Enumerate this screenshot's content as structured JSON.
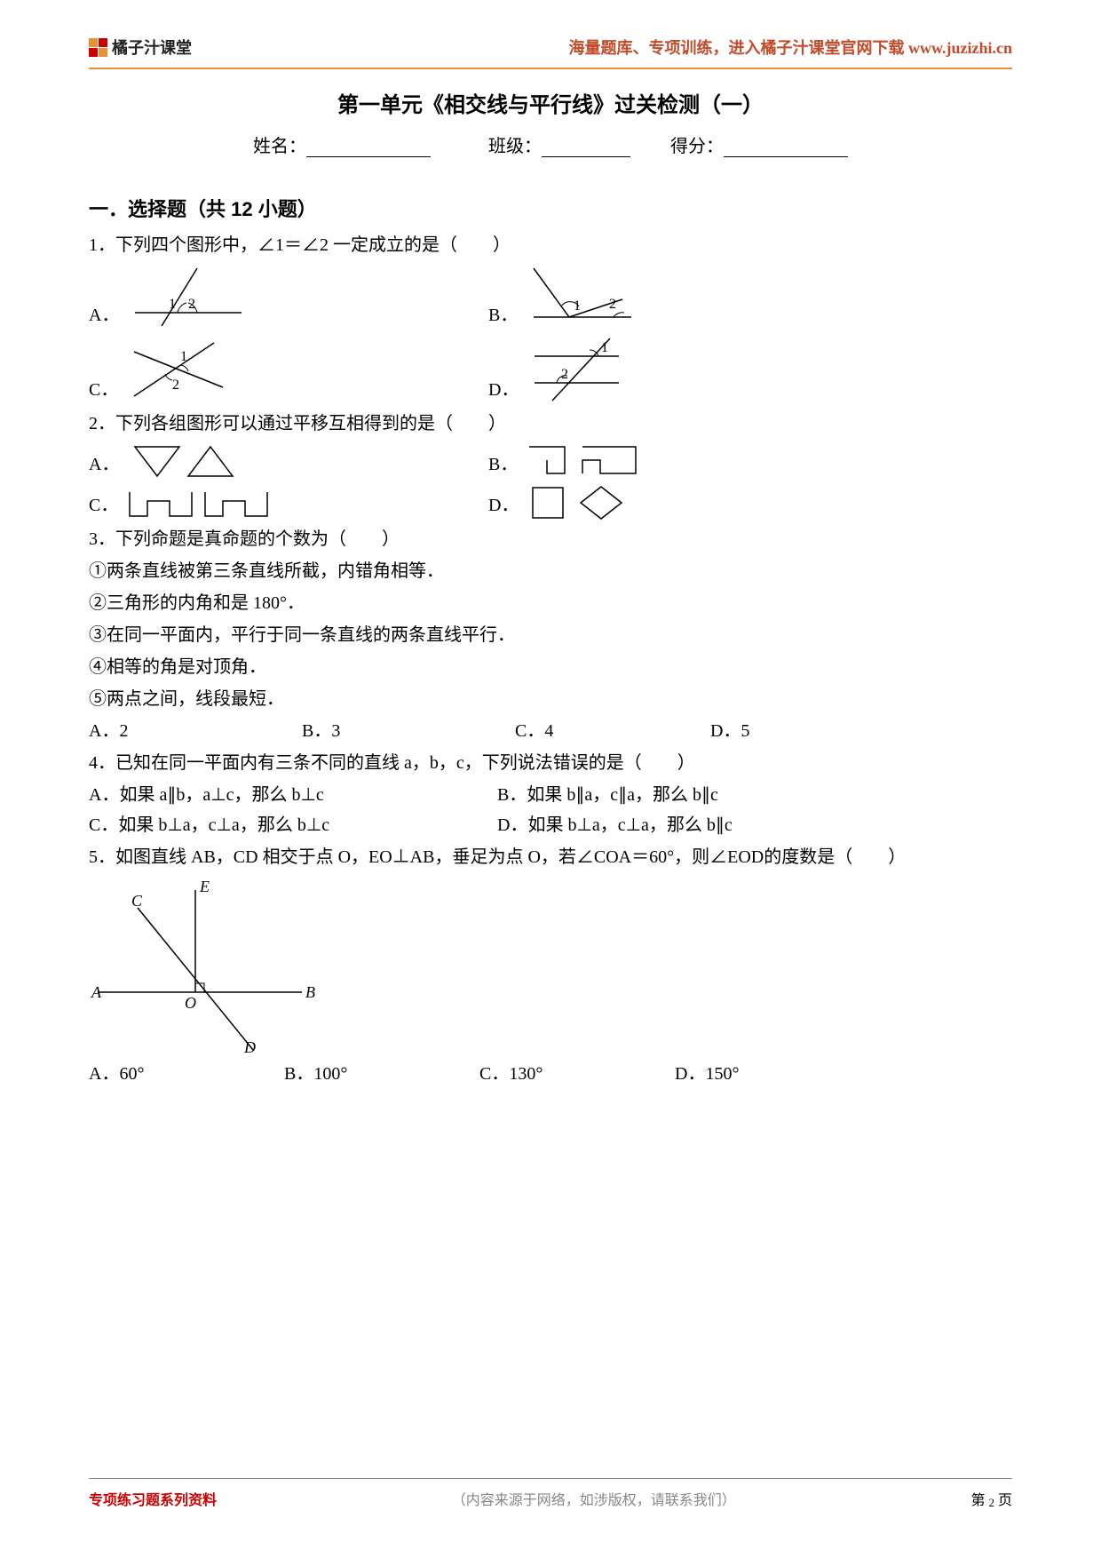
{
  "header": {
    "brand": "橘子汁课堂",
    "tagline": "海量题库、专项训练，进入橘子汁课堂官网下载 www.juzizhi.cn"
  },
  "title": "第一单元《相交线与平行线》过关检测（一）",
  "info": {
    "name_label": "姓名：",
    "class_label": "班级：",
    "score_label": "得分："
  },
  "section1": {
    "heading": "一．选择题（共 12 小题）",
    "q1": {
      "text": "1．下列四个图形中，∠1＝∠2 一定成立的是（　　）",
      "optA": "A．",
      "optB": "B．",
      "optC": "C．",
      "optD": "D．",
      "label1": "1",
      "label2": "2"
    },
    "q2": {
      "text": "2．下列各组图形可以通过平移互相得到的是（　　）",
      "optA": "A．",
      "optB": "B．",
      "optC": "C．",
      "optD": "D．"
    },
    "q3": {
      "text": "3．下列命题是真命题的个数为（　　）",
      "s1": "①两条直线被第三条直线所截，内错角相等．",
      "s2": "②三角形的内角和是 180°．",
      "s3": "③在同一平面内，平行于同一条直线的两条直线平行．",
      "s4": "④相等的角是对顶角．",
      "s5": "⑤两点之间，线段最短．",
      "optA": "A．2",
      "optB": "B．3",
      "optC": "C．4",
      "optD": "D．5"
    },
    "q4": {
      "text": "4．已知在同一平面内有三条不同的直线 a，b，c，下列说法错误的是（　　）",
      "optA": "A．如果 a∥b，a⊥c，那么 b⊥c",
      "optB": "B．如果 b∥a，c∥a，那么 b∥c",
      "optC": "C．如果 b⊥a，c⊥a，那么 b⊥c",
      "optD": "D．如果 b⊥a，c⊥a，那么 b∥c"
    },
    "q5": {
      "text": "5．如图直线 AB，CD 相交于点 O，EO⊥AB，垂足为点 O，若∠COA＝60°，则∠EOD的度数是（　　）",
      "optA": "A．60°",
      "optB": "B．100°",
      "optC": "C．130°",
      "optD": "D．150°",
      "labelA": "A",
      "labelB": "B",
      "labelC": "C",
      "labelD": "D",
      "labelE": "E",
      "labelO": "O"
    }
  },
  "footer": {
    "left": "专项练习题系列资料",
    "mid": "（内容来源于网络，如涉版权，请联系我们）",
    "right_prefix": "第 ",
    "page_num": "2",
    "right_suffix": " 页"
  }
}
